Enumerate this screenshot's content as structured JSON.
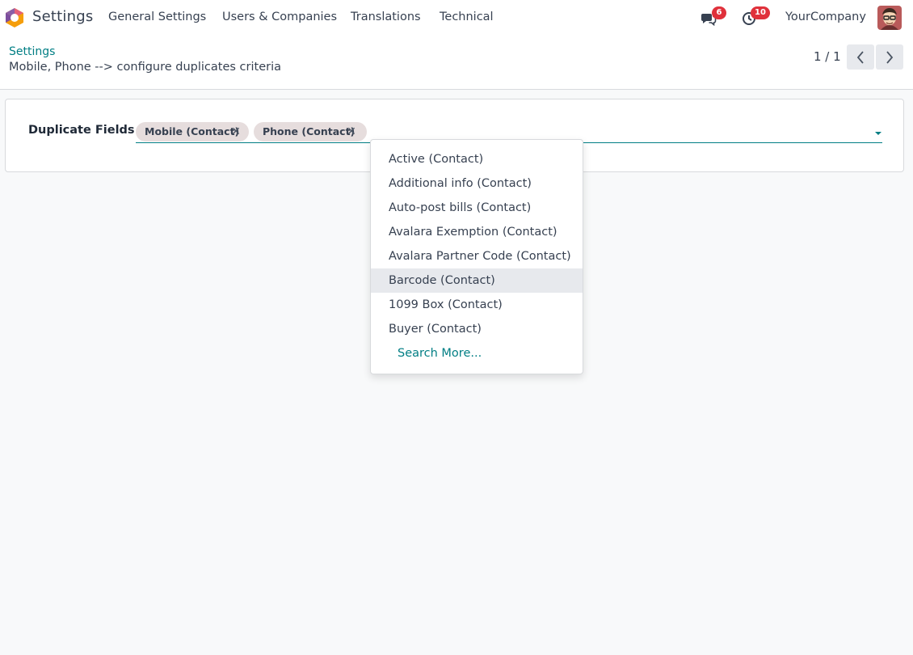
{
  "navbar": {
    "app_name": "Settings",
    "menu": [
      {
        "label": "General Settings"
      },
      {
        "label": "Users & Companies"
      },
      {
        "label": "Translations"
      },
      {
        "label": "Technical"
      }
    ],
    "discuss_badge": "6",
    "activity_badge": "10",
    "company": "YourCompany",
    "icons": {
      "logo": "odoo-hexagon-icon",
      "discuss": "chat-bubbles-icon",
      "activity": "clock-icon",
      "avatar": "user-avatar"
    }
  },
  "control_panel": {
    "breadcrumb": "Settings",
    "title": "Mobile, Phone --> configure duplicates criteria",
    "pager": "1 / 1",
    "icons": {
      "prev": "chevron-left-icon",
      "next": "chevron-right-icon"
    }
  },
  "form": {
    "field_label": "Duplicate Fields",
    "tags": [
      {
        "label": "Mobile (Contact)",
        "remove": "✕"
      },
      {
        "label": "Phone (Contact)",
        "remove": "✕"
      }
    ]
  },
  "dropdown": {
    "items": [
      {
        "label": "Active (Contact)"
      },
      {
        "label": "Additional info (Contact)"
      },
      {
        "label": "Auto-post bills (Contact)"
      },
      {
        "label": "Avalara Exemption (Contact)"
      },
      {
        "label": "Avalara Partner Code (Contact)"
      },
      {
        "label": "Barcode (Contact)"
      },
      {
        "label": "1099 Box (Contact)"
      },
      {
        "label": "Buyer (Contact)"
      }
    ],
    "highlighted": "Barcode (Contact)",
    "search_more": "Search More..."
  },
  "colors": {
    "accent": "#017e84",
    "badge": "#e0313b",
    "tag_bg": "#e6dddd",
    "highlight": "#e7e9ed"
  }
}
